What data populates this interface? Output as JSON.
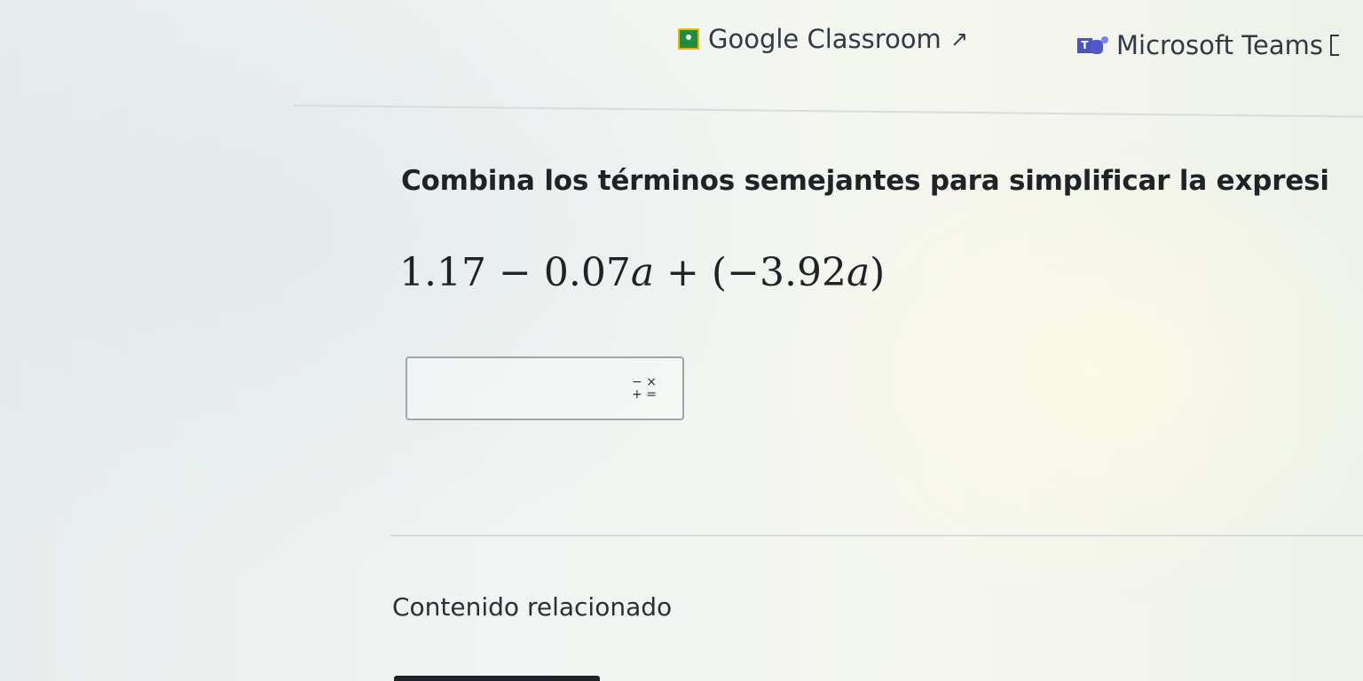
{
  "share": {
    "classroom": {
      "label": "Google Classroom",
      "icon": "google-classroom-icon"
    },
    "teams": {
      "label": "Microsoft Teams",
      "icon": "microsoft-teams-icon"
    },
    "external_icon": "external-link-icon"
  },
  "problem": {
    "prompt": "Combina los términos semejantes para simplificar la expresi",
    "expression": {
      "constant": "1.17",
      "op1": "−",
      "coef1": "0.07",
      "var1": "a",
      "op2": "+",
      "open": "(",
      "coef2": "−3.92",
      "var2": "a",
      "close": ")"
    }
  },
  "answer": {
    "value": "",
    "keypad_top": "− ×",
    "keypad_bottom": "+ ="
  },
  "related": {
    "heading": "Contenido relacionado"
  },
  "colors": {
    "classroom_green": "#1e8e3e",
    "classroom_yellow": "#f2b600",
    "teams_purple": "#5059c9"
  }
}
